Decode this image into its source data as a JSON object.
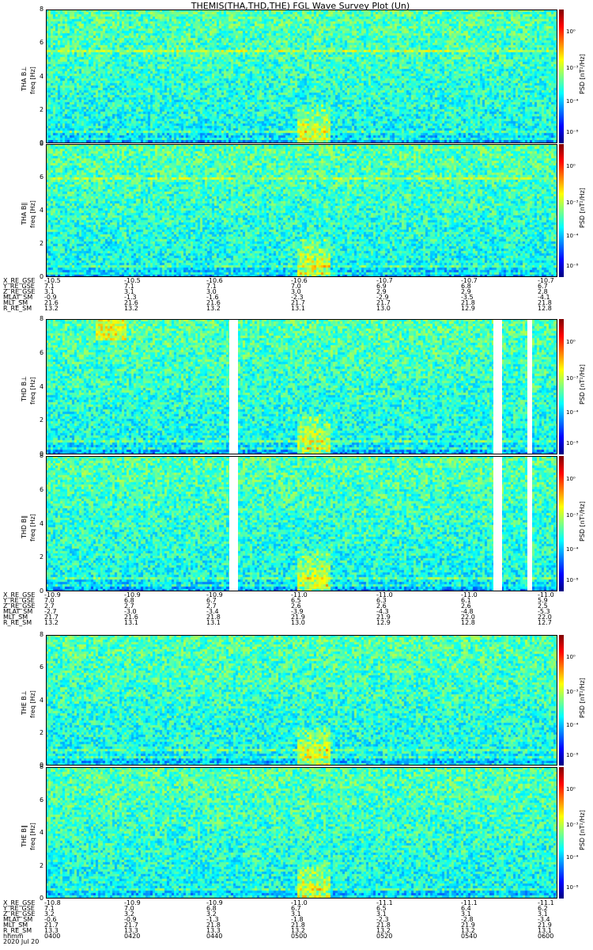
{
  "title": "THEMIS(THA,THD,THE) FGL Wave Survey Plot (Un)",
  "colorbar": {
    "label": "PSD [nT²/Hz]",
    "ticks": [
      "10⁰",
      "10⁻³",
      "10⁻⁴",
      "10⁻⁸"
    ]
  },
  "chart_data": {
    "type": "heatmap",
    "ylim": [
      0,
      8
    ],
    "yticks": [
      "0",
      "2",
      "4",
      "6",
      "8"
    ],
    "ylabel": "freq [Hz]",
    "xlim": [
      "0400",
      "0600"
    ],
    "panels": [
      {
        "probe": "THA",
        "component": "THA B⊥",
        "xlabel": "freq [Hz]"
      },
      {
        "probe": "THA",
        "component": "THA B∥",
        "xlabel": "freq [Hz]"
      },
      {
        "probe": "THD",
        "component": "THD B⊥",
        "xlabel": "freq [Hz]"
      },
      {
        "probe": "THD",
        "component": "THD B∥",
        "xlabel": "freq [Hz]"
      },
      {
        "probe": "THE",
        "component": "THE B⊥",
        "xlabel": "freq [Hz]"
      },
      {
        "probe": "THE",
        "component": "THE B∥",
        "xlabel": "freq [Hz]"
      }
    ],
    "ephemeris": [
      {
        "probe": "THA",
        "rows": [
          {
            "name": "X_RE_GSE",
            "values": [
              "-10.5",
              "-10.5",
              "-10.6",
              "-10.6",
              "-10.7",
              "-10.7",
              "-10.7"
            ]
          },
          {
            "name": "Y_RE_GSE",
            "values": [
              "7.1",
              "7.1",
              "7.1",
              "7.0",
              "6.9",
              "6.8",
              "6.7"
            ]
          },
          {
            "name": "Z_RE_GSE",
            "values": [
              "3.1",
              "3.1",
              "3.0",
              "3.0",
              "2.9",
              "2.9",
              "2.8"
            ]
          },
          {
            "name": "MLAT_SM",
            "values": [
              "-0.9",
              "-1.3",
              "-1.6",
              "-2.3",
              "-2.9",
              "-3.5",
              "-4.1"
            ]
          },
          {
            "name": "MLT_SM",
            "values": [
              "21.6",
              "21.6",
              "21.6",
              "21.7",
              "21.7",
              "21.8",
              "21.8"
            ]
          },
          {
            "name": "R_RE_SM",
            "values": [
              "13.2",
              "13.2",
              "13.2",
              "13.1",
              "13.0",
              "12.9",
              "12.8"
            ]
          }
        ]
      },
      {
        "probe": "THD",
        "rows": [
          {
            "name": "X_RE_GSE",
            "values": [
              "-10.9",
              "-10.9",
              "-10.9",
              "-11.0",
              "-11.0",
              "-11.0",
              "-11.0"
            ]
          },
          {
            "name": "Y_RE_GSE",
            "values": [
              "7.0",
              "6.8",
              "6.7",
              "6.5",
              "6.3",
              "6.1",
              "5.9"
            ]
          },
          {
            "name": "Z_RE_GSE",
            "values": [
              "2.7",
              "2.7",
              "2.7",
              "2.6",
              "2.6",
              "2.6",
              "2.5"
            ]
          },
          {
            "name": "MLAT_SM",
            "values": [
              "-2.7",
              "-3.0",
              "-3.4",
              "-3.9",
              "-4.3",
              "-4.8",
              "-5.3"
            ]
          },
          {
            "name": "MLT_SM",
            "values": [
              "21.7",
              "21.6",
              "21.8",
              "21.9",
              "21.9",
              "22.0",
              "22.0"
            ]
          },
          {
            "name": "R_RE_SM",
            "values": [
              "13.2",
              "13.1",
              "13.1",
              "13.0",
              "12.9",
              "12.8",
              "12.7"
            ]
          }
        ]
      },
      {
        "probe": "THE",
        "rows": [
          {
            "name": "X_RE_GSE",
            "values": [
              "-10.8",
              "-10.9",
              "-10.9",
              "-11.0",
              "-11.1",
              "-11.1",
              "-11.1"
            ]
          },
          {
            "name": "Y_RE_GSE",
            "values": [
              "7.1",
              "7.0",
              "6.8",
              "6.7",
              "6.5",
              "6.4",
              "6.2"
            ]
          },
          {
            "name": "Z_RE_GSE",
            "values": [
              "3.2",
              "3.2",
              "3.2",
              "3.1",
              "3.1",
              "3.1",
              "3.1"
            ]
          },
          {
            "name": "MLAT_SM",
            "values": [
              "-0.6",
              "-0.9",
              "-1.3",
              "-1.8",
              "-2.3",
              "-2.8",
              "-3.4"
            ]
          },
          {
            "name": "MLT_SM",
            "values": [
              "21.7",
              "21.7",
              "21.8",
              "21.8",
              "21.8",
              "21.9",
              "21.9"
            ]
          },
          {
            "name": "R_RE_SM",
            "values": [
              "13.3",
              "13.3",
              "13.3",
              "13.2",
              "13.2",
              "13.2",
              "13.1"
            ]
          },
          {
            "name": "hhmm",
            "values": [
              "0400",
              "0420",
              "0440",
              "0500",
              "0520",
              "0540",
              "0600"
            ]
          }
        ]
      }
    ],
    "date_label": "2020 Jul 20",
    "color_scale": [
      "#00007f",
      "#0000ff",
      "#0080ff",
      "#00ffff",
      "#80ff80",
      "#ffff00",
      "#ff8000",
      "#ff0000",
      "#7f0000"
    ],
    "data_gaps": [
      {
        "probe": "THD",
        "start": "0443",
        "end": "0445"
      },
      {
        "probe": "THD",
        "start": "0545",
        "end": "0547"
      },
      {
        "probe": "THD",
        "start": "0553",
        "end": "0554"
      }
    ]
  }
}
